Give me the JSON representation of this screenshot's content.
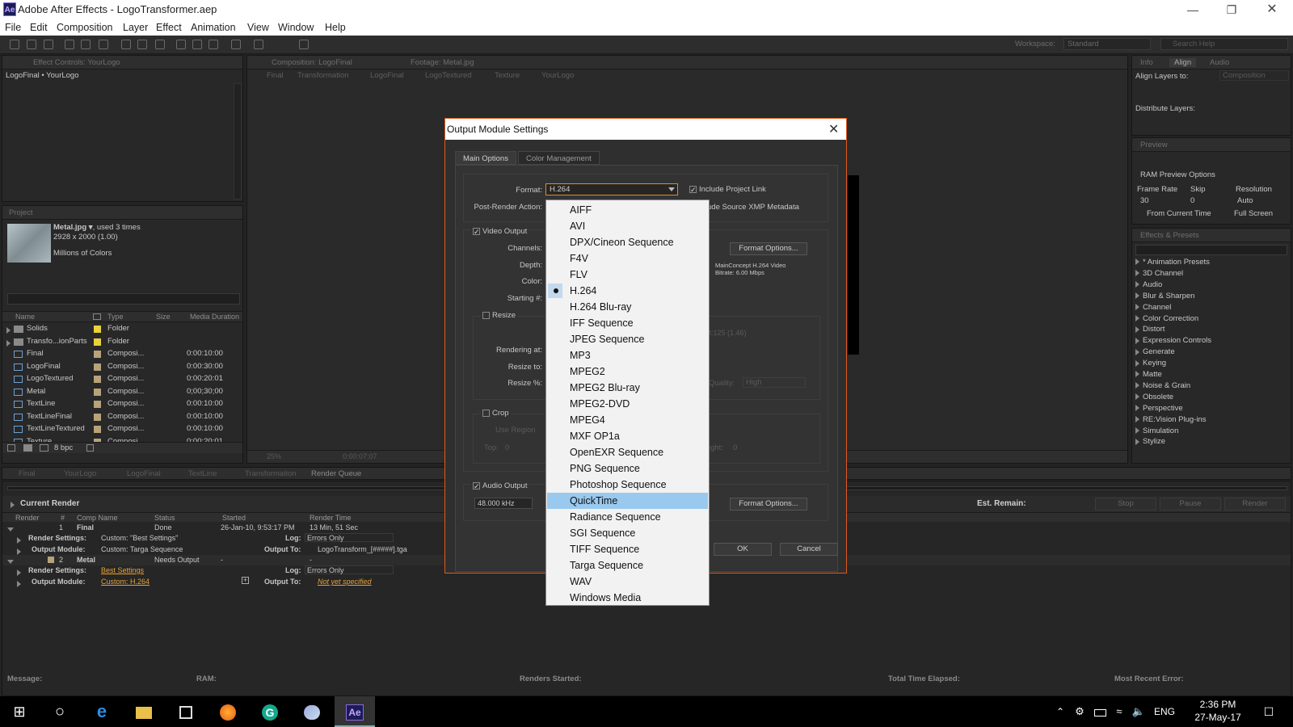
{
  "app": {
    "title": "Adobe After Effects - LogoTransformer.aep",
    "logo": "Ae"
  },
  "menu": [
    "File",
    "Edit",
    "Composition",
    "Layer",
    "Effect",
    "Animation",
    "View",
    "Window",
    "Help"
  ],
  "toolbar": {
    "workspace_label": "Workspace:",
    "workspace_value": "Standard",
    "search_placeholder": "Search Help"
  },
  "effect_controls": {
    "tab": "Effect Controls: YourLogo",
    "path": "LogoFinal • YourLogo"
  },
  "comp_panel": {
    "tab": "Composition: LogoFinal",
    "footage_tab": "Footage: Metal.jpg",
    "breadcrumbs": [
      "Final",
      "Transformation",
      "LogoFinal",
      "LogoTextured",
      "Texture",
      "YourLogo"
    ],
    "zoom": "25%",
    "timecode": "0:00:07:07"
  },
  "project": {
    "tab": "Project",
    "item_name": "Metal.jpg ▾",
    "used": ", used 3 times",
    "dims": "2928 x 2000 (1.00)",
    "colors": "Millions of Colors",
    "columns": [
      "Name",
      "Type",
      "Size",
      "Media Duration"
    ],
    "bpc": "8 bpc",
    "items": [
      {
        "name": "Solids",
        "type": "Folder",
        "duration": "",
        "kind": "folder",
        "color": "#e8d23a"
      },
      {
        "name": "Transfo...ionParts",
        "type": "Folder",
        "duration": "",
        "kind": "folder",
        "color": "#e8d23a"
      },
      {
        "name": "Final",
        "type": "Composi...",
        "duration": "0:00:10:00",
        "kind": "comp",
        "color": "#b8a27a"
      },
      {
        "name": "LogoFinal",
        "type": "Composi...",
        "duration": "0:00:30:00",
        "kind": "comp",
        "color": "#b8a27a"
      },
      {
        "name": "LogoTextured",
        "type": "Composi...",
        "duration": "0:00:20:01",
        "kind": "comp",
        "color": "#b8a27a"
      },
      {
        "name": "Metal",
        "type": "Composi...",
        "duration": "0;00;30;00",
        "kind": "comp",
        "color": "#b8a27a"
      },
      {
        "name": "TextLine",
        "type": "Composi...",
        "duration": "0:00:10:00",
        "kind": "comp",
        "color": "#b8a27a"
      },
      {
        "name": "TextLineFinal",
        "type": "Composi...",
        "duration": "0:00:10:00",
        "kind": "comp",
        "color": "#b8a27a"
      },
      {
        "name": "TextLineTextured",
        "type": "Composi...",
        "duration": "0:00:10:00",
        "kind": "comp",
        "color": "#b8a27a"
      },
      {
        "name": "Texture",
        "type": "Composi...",
        "duration": "0:00:20:01",
        "kind": "comp",
        "color": "#b8a27a"
      }
    ]
  },
  "right": {
    "tabs": [
      "Info",
      "Align",
      "Audio"
    ],
    "align_to_label": "Align Layers to:",
    "align_to_value": "Composition",
    "distribute": "Distribute Layers:",
    "preview_tab": "Preview",
    "ram_options": "RAM Preview Options",
    "frame_rate": "Frame Rate",
    "skip": "Skip",
    "resolution": "Resolution",
    "fr_value": "30",
    "skip_value": "0",
    "res_value": "Auto",
    "from_current": "From Current Time",
    "full_screen": "Full Screen",
    "effects_tab": "Effects & Presets",
    "effects": [
      "* Animation Presets",
      "3D Channel",
      "Audio",
      "Blur & Sharpen",
      "Channel",
      "Color Correction",
      "Distort",
      "Expression Controls",
      "Generate",
      "Keying",
      "Matte",
      "Noise & Grain",
      "Obsolete",
      "Perspective",
      "RE:Vision Plug-ins",
      "Simulation",
      "Stylize"
    ]
  },
  "bottom_tabs": [
    "Final",
    "YourLogo",
    "LogoFinal",
    "TextLine",
    "Transformation",
    "Render Queue"
  ],
  "render_queue": {
    "current_render": "Current Render",
    "est_remain": "Est. Remain:",
    "stop": "Stop",
    "pause": "Pause",
    "render": "Render",
    "columns": [
      "Render",
      "#",
      "Comp Name",
      "Status",
      "Started",
      "Render Time"
    ],
    "item1": {
      "num": "1",
      "name": "Final",
      "status": "Done",
      "started": "26-Jan-10, 9:53:17 PM",
      "time": "13 Min, 51 Sec",
      "rs_label": "Render Settings:",
      "rs_value": "Custom: \"Best Settings\"",
      "log_label": "Log:",
      "log_value": "Errors Only",
      "om_label": "Output Module:",
      "om_value": "Custom: Targa Sequence",
      "out_label": "Output To:",
      "out_value": "LogoTransform_[#####].tga"
    },
    "item2": {
      "num": "2",
      "name": "Metal",
      "status": "Needs Output",
      "started": "-",
      "time": "-",
      "rs_label": "Render Settings:",
      "rs_value": "Best Settings",
      "log_label": "Log:",
      "log_value": "Errors Only",
      "om_label": "Output Module:",
      "om_value": "Custom: H.264",
      "out_label": "Output To:",
      "out_value": "Not yet specified"
    },
    "status": {
      "message": "Message:",
      "ram": "RAM:",
      "renders_started": "Renders Started:",
      "total_time": "Total Time Elapsed:",
      "recent_error": "Most Recent Error:"
    }
  },
  "dialog": {
    "title": "Output Module Settings",
    "tabs": [
      "Main Options",
      "Color Management"
    ],
    "format_label": "Format:",
    "format_value": "H.264",
    "include_link": "Include Project Link",
    "post_render_label": "Post-Render Action:",
    "include_xmp": "ude Source XMP Metadata",
    "video_output": "Video Output",
    "channels": "Channels:",
    "depth": "Depth:",
    "color": "Color:",
    "starting": "Starting #:",
    "format_options": "Format Options...",
    "codec_info1": "MainConcept H.264 Video",
    "codec_info2": "Bitrate: 6.00 Mbps",
    "resize": "Resize",
    "ratio": "3:125 (1.46)",
    "rendering_at": "Rendering at:",
    "resize_to": "Resize to:",
    "resize_pct": "Resize %:",
    "quality_label": "Quality:",
    "quality_value": "High",
    "crop": "Crop",
    "use_region": "Use Region",
    "top_label": "Top:",
    "top_value": "0",
    "right_label": "ight:",
    "right_value": "0",
    "audio_output": "Audio Output",
    "audio_rate": "48.000 kHz",
    "audio_format_options": "Format Options...",
    "ok": "OK",
    "cancel": "Cancel"
  },
  "format_list": {
    "items": [
      "AIFF",
      "AVI",
      "DPX/Cineon Sequence",
      "F4V",
      "FLV",
      "H.264",
      "H.264 Blu-ray",
      "IFF Sequence",
      "JPEG Sequence",
      "MP3",
      "MPEG2",
      "MPEG2 Blu-ray",
      "MPEG2-DVD",
      "MPEG4",
      "MXF OP1a",
      "OpenEXR Sequence",
      "PNG Sequence",
      "Photoshop Sequence",
      "QuickTime",
      "Radiance Sequence",
      "SGI Sequence",
      "TIFF Sequence",
      "Targa Sequence",
      "WAV",
      "Windows Media"
    ],
    "checked": "H.264",
    "highlighted": "QuickTime"
  },
  "taskbar": {
    "time": "2:36 PM",
    "date": "27-May-17",
    "lang": "ENG"
  }
}
